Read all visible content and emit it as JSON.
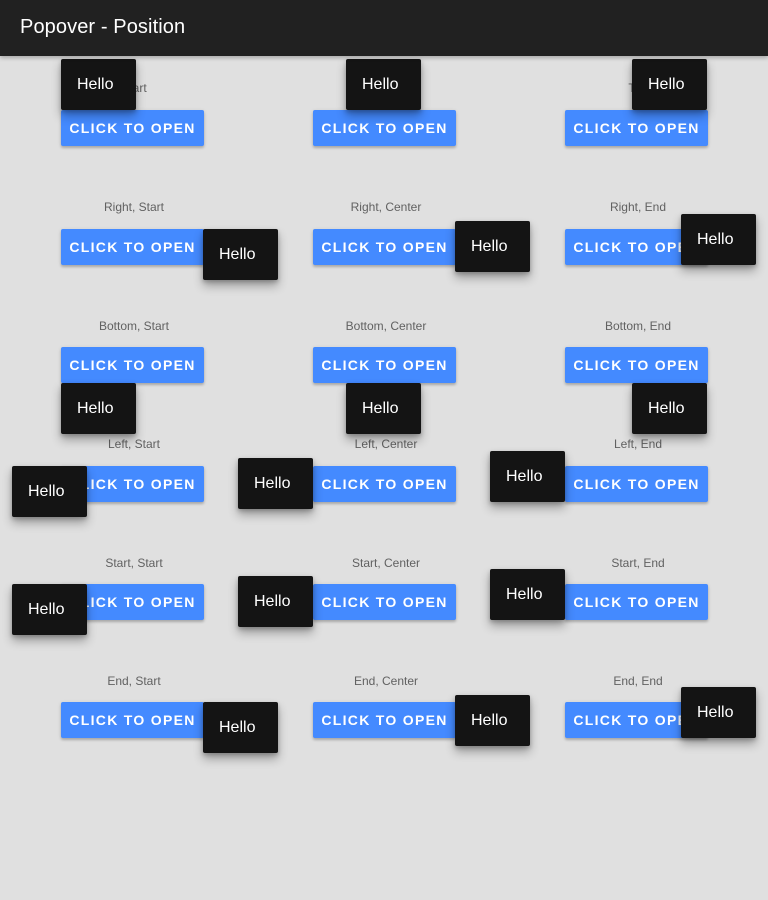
{
  "app": {
    "title": "Popover - Position"
  },
  "captions": [
    "Start",
    "",
    "Top",
    "Right, Start",
    "Right, Center",
    "Right, End",
    "Bottom, Start",
    "Bottom, Center",
    "Bottom, End",
    "Left, Start",
    "Left, Center",
    "Left, End",
    "Start, Start",
    "Start, Center",
    "Start, End",
    "End, Start",
    "End, Center",
    "End, End"
  ],
  "button_label": "CLICK TO OPEN",
  "popover_text": "Hello"
}
